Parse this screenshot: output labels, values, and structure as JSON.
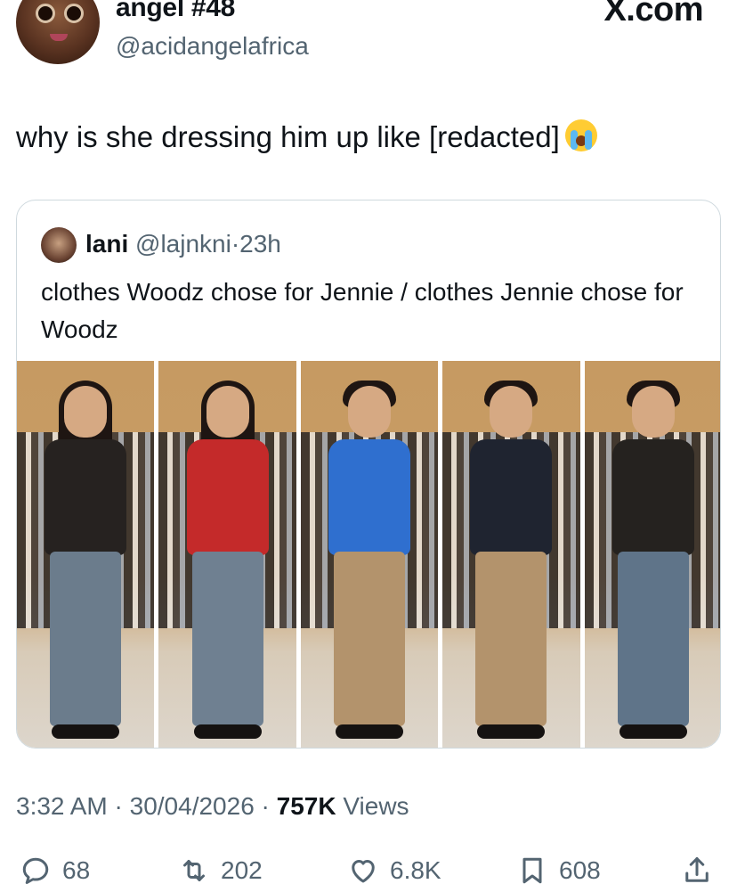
{
  "header": {
    "display_name": "angel #48",
    "handle": "@acidangelafrica",
    "watermark": "X.com"
  },
  "tweet": {
    "text": "why is she dressing him up like [redacted]",
    "emoji": "crying-face"
  },
  "quoted_tweet": {
    "name": "lani",
    "handle": "@lajnkni",
    "separator": "·",
    "time": "23h",
    "text": "clothes Woodz chose for Jennie / clothes Jennie chose for Woodz"
  },
  "meta": {
    "time": "3:32 AM",
    "sep1": " · ",
    "date": "30/04/2026",
    "sep2": " · ",
    "views_count": "757K",
    "views_label": " Views"
  },
  "actions": {
    "replies": "68",
    "reposts": "202",
    "likes": "6.8K",
    "bookmarks": "608"
  },
  "colors": {
    "text": "#0f1419",
    "secondary": "#536471",
    "border": "#cfd9de"
  }
}
